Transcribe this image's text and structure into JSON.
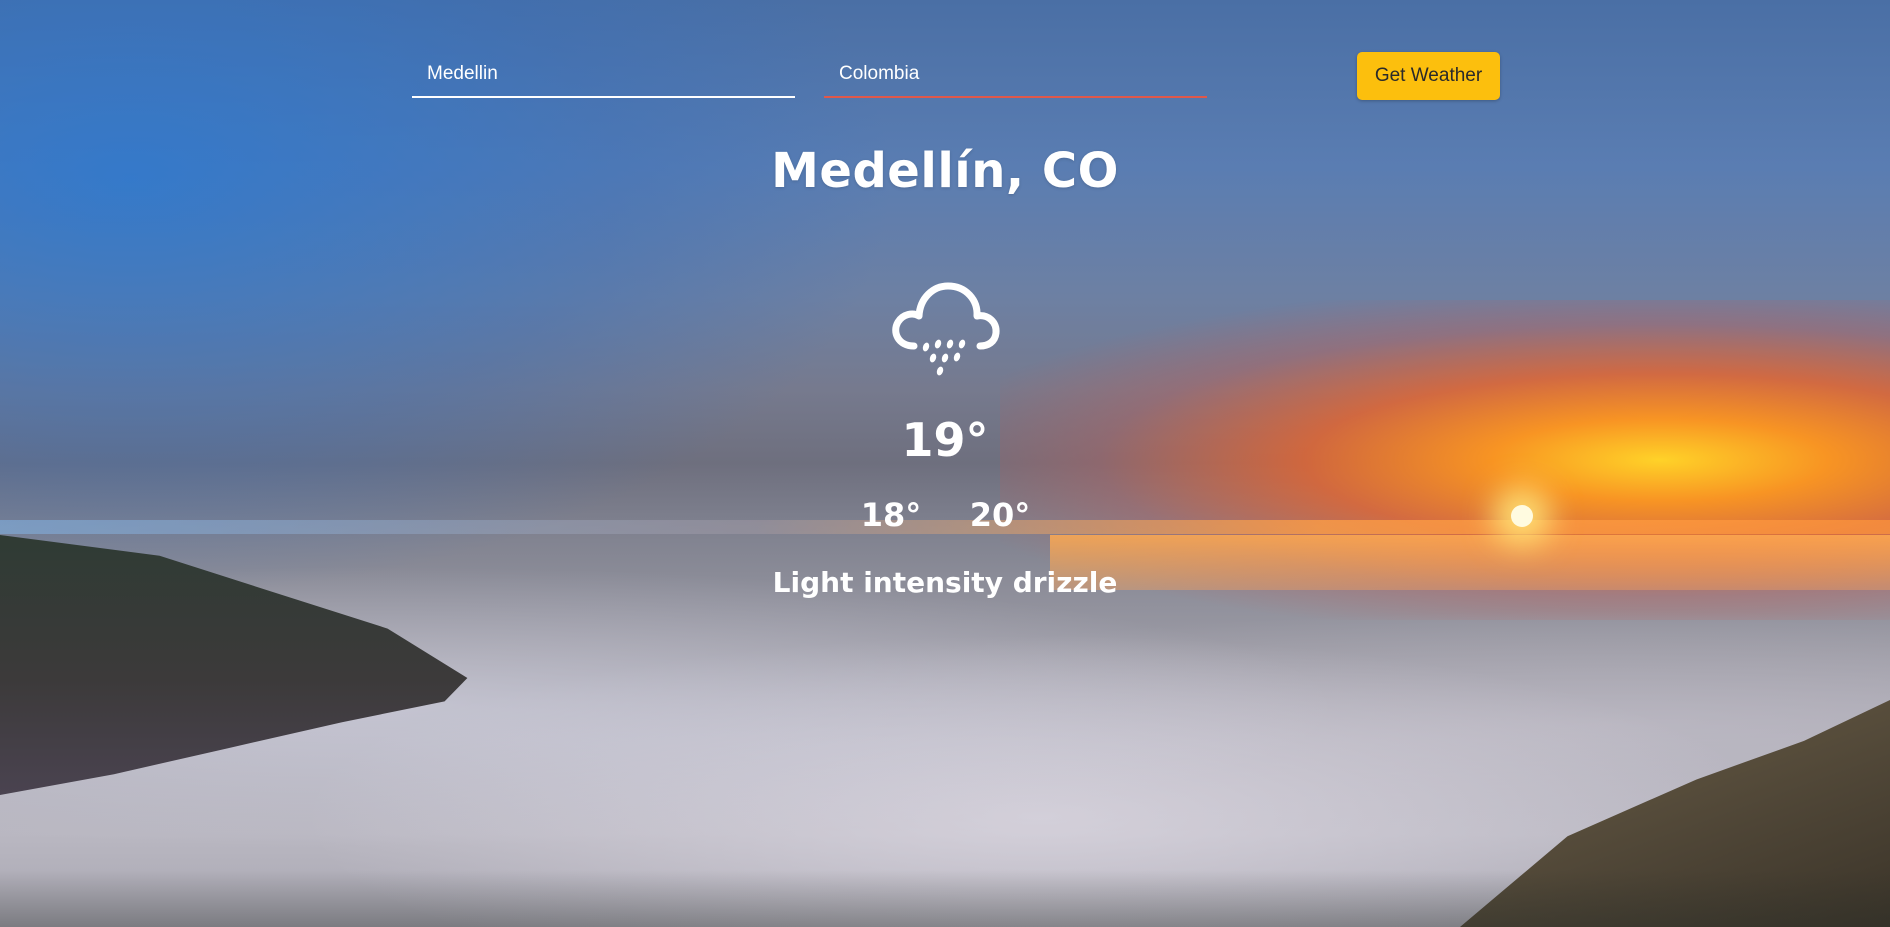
{
  "search": {
    "city_value": "Medellin",
    "country_value": "Colombia",
    "button_label": "Get Weather"
  },
  "weather": {
    "location": "Medellín, CO",
    "icon": "rain-cloud-icon",
    "temperature": "19°",
    "temp_min": "18°",
    "temp_max": "20°",
    "description": "Light intensity drizzle"
  },
  "colors": {
    "button": "#fcbf0d",
    "active_underline": "#e0584a",
    "text": "#ffffff"
  }
}
